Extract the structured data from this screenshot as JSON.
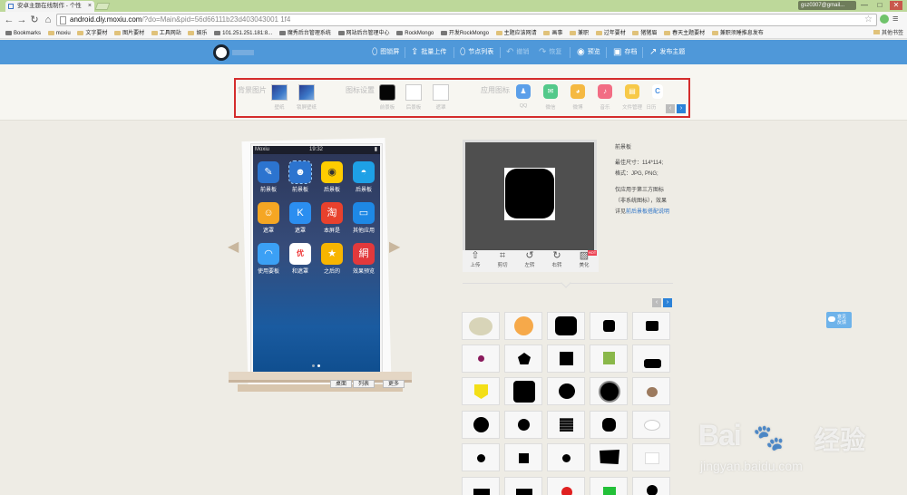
{
  "browser": {
    "tab_title": "安卓主题在线制作 - 个性",
    "tab_close": "×",
    "account": "gsz0307@gmail...",
    "window_controls": [
      "—",
      "□",
      "✕"
    ],
    "url_host": "android.diy.moxiu.com",
    "url_rest": "/?do=Main&pid=56d66111b23d403043001 1f4",
    "nav": {
      "back": "←",
      "forward": "→",
      "reload": "↻",
      "home": "⌂"
    },
    "bookmarks": [
      "Bookmarks",
      "moxiu",
      "文字要材",
      "图片要材",
      "工具网站",
      "娱乐",
      "101.251.251.181:8...",
      "魔秀后台管理系统",
      "网站后台管理中心",
      "RockMongo",
      "开发RockMongo",
      "主题应该网请",
      "画事",
      "兼职",
      "过年要材",
      "猪猪眉",
      "春天主题要材",
      "兼职须睡推息发布"
    ],
    "other_bookmarks": "其他书签"
  },
  "header": {
    "buttons": [
      {
        "label": "图锁屏",
        "icon": "⬯"
      },
      {
        "label": "批量上传",
        "icon": "⇪"
      },
      {
        "label": "节点列表",
        "icon": "⬯"
      },
      {
        "label": "撤销",
        "icon": "↶"
      },
      {
        "label": "恢复",
        "icon": "↷"
      },
      {
        "label": "预览",
        "icon": "◉"
      },
      {
        "label": "存档",
        "icon": "▣"
      },
      {
        "label": "发布主题",
        "icon": "↗"
      }
    ]
  },
  "panel": {
    "bg_label": "背景图片",
    "bg_items": [
      "壁纸",
      "锁屏壁纸"
    ],
    "icon_label": "图标设置",
    "icon_items": [
      "前景板",
      "后景板",
      "遮罩"
    ],
    "app_label": "应用图标",
    "app_items": [
      {
        "label": "QQ",
        "color": "#5b9fe9",
        "icon": "♟"
      },
      {
        "label": "微信",
        "color": "#53c98a",
        "icon": "✉"
      },
      {
        "label": "微博",
        "color": "#f5b942",
        "icon": "◕"
      },
      {
        "label": "音乐",
        "color": "#f26d84",
        "icon": "♪"
      },
      {
        "label": "文件管理",
        "color": "#f7c948",
        "icon": "▤"
      },
      {
        "label": "日历",
        "color": "#4a90e2",
        "icon": "C"
      }
    ],
    "prev": "‹",
    "next": "›"
  },
  "phone": {
    "carrier": "Moxiu",
    "time": "19:32",
    "battery": "▮",
    "apps": [
      {
        "label": "前景板",
        "color": "#2c74cf",
        "icon": "✎"
      },
      {
        "label": "前景板",
        "color": "#2c74cf",
        "icon": "☻"
      },
      {
        "label": "后景板",
        "color": "#ffcc00",
        "icon": "◉"
      },
      {
        "label": "后景板",
        "color": "#1ea0e6",
        "icon": "◓"
      },
      {
        "label": "遮罩",
        "color": "#f5a623",
        "icon": "☺"
      },
      {
        "label": "遮罩",
        "color": "#2b8ef0",
        "icon": "K"
      },
      {
        "label": "本屏是",
        "color": "#e8412d",
        "icon": "淘"
      },
      {
        "label": "其他应用",
        "color": "#1e88e5",
        "icon": "▭"
      },
      {
        "label": "使用要板",
        "color": "#3ba0f5",
        "icon": "◠"
      },
      {
        "label": "和遮罩",
        "color": "#ffffff",
        "icon": "优"
      },
      {
        "label": "之后的",
        "color": "#f7b500",
        "icon": "★"
      },
      {
        "label": "效果预览",
        "color": "#e2393c",
        "icon": "網"
      }
    ],
    "tabs": [
      "桌面",
      "列表",
      "更多"
    ],
    "left_arrow": "◀",
    "right_arrow": "▶"
  },
  "editor": {
    "tools": [
      {
        "label": "上传",
        "icon": "⇧"
      },
      {
        "label": "剪切",
        "icon": "⌗"
      },
      {
        "label": "左转",
        "icon": "↺"
      },
      {
        "label": "右转",
        "icon": "↻"
      },
      {
        "label": "美化",
        "icon": "▨"
      }
    ],
    "hot": "HOT",
    "info": {
      "title": "前景板",
      "size": "最佳尺寸：114*114;",
      "format": "格式：JPG, PNG;",
      "desc1": "仅应用于第三方图标",
      "desc2": "（非系统图标），效果",
      "desc3_prefix": "详见",
      "desc3_link": "前后景板搭配说明"
    },
    "grid_prev": "‹",
    "grid_next": "›"
  },
  "feedback": {
    "line1": "意见",
    "line2": "反馈"
  },
  "watermark": {
    "brand": "Bai",
    "brand2": "经验",
    "domain": "jingyan.baidu.com"
  },
  "colors": {
    "header_blue": "#4f98d9",
    "highlight_red": "#d42c2c",
    "grid_active": "#2b82d8"
  }
}
